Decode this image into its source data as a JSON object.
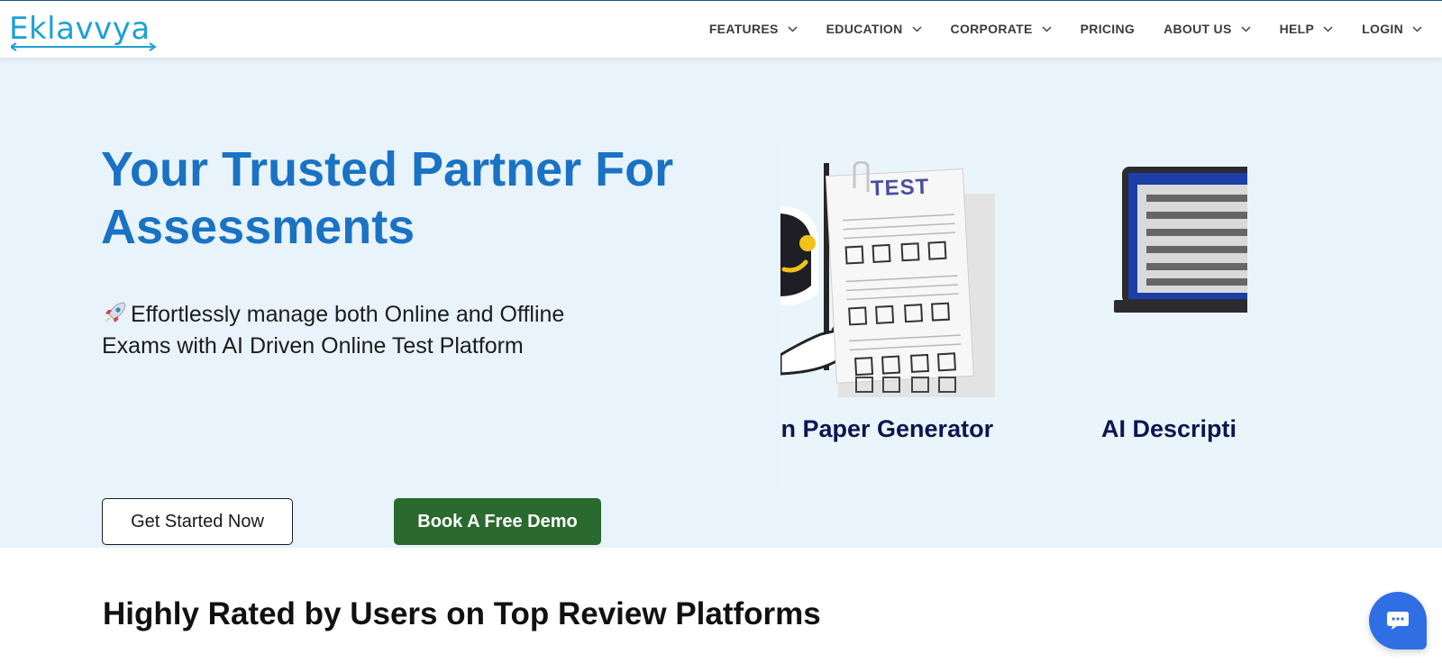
{
  "brand": {
    "name": "Eklavvya",
    "color": "#1da1d6"
  },
  "nav": {
    "items": [
      {
        "label": "FEATURES",
        "dropdown": true
      },
      {
        "label": "EDUCATION",
        "dropdown": true
      },
      {
        "label": "CORPORATE",
        "dropdown": true
      },
      {
        "label": "PRICING",
        "dropdown": false
      },
      {
        "label": "ABOUT US",
        "dropdown": true
      },
      {
        "label": "HELP",
        "dropdown": true
      },
      {
        "label": "LOGIN",
        "dropdown": true
      }
    ]
  },
  "hero": {
    "title_line1": "Your Trusted Partner For",
    "title_line2": "Assessments",
    "subtitle_icon": "rocket-icon",
    "subtitle_line1": "Effortlessly manage both Online and Offline",
    "subtitle_line2": "Exams with AI Driven Online Test Platform",
    "primary_button": "Get Started Now",
    "secondary_button": "Book A Free Demo",
    "colors": {
      "title": "#1a72c4",
      "background": "#e8f3fb",
      "demo_button": "#2b6a2e"
    }
  },
  "slider": {
    "slides": [
      {
        "caption": "on Paper Generator",
        "art_label": "TEST",
        "icon": "test-paper-robot-icon"
      },
      {
        "caption": "AI Descripti",
        "icon": "laptop-icon"
      }
    ]
  },
  "reviews": {
    "title": "Highly Rated by Users on Top Review Platforms"
  },
  "chat": {
    "icon": "chat-bubble-icon",
    "color": "#2f6fe3"
  }
}
